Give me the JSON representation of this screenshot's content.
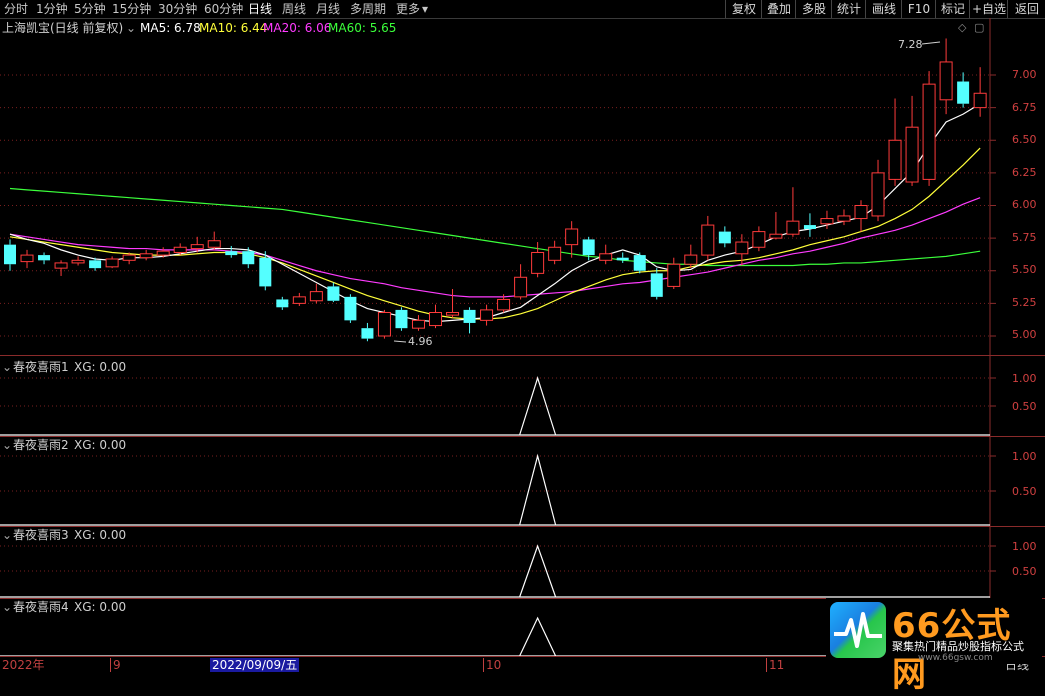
{
  "toolbar": {
    "periods": [
      "分时",
      "1分钟",
      "5分钟",
      "15分钟",
      "30分钟",
      "60分钟",
      "日线",
      "周线",
      "月线",
      "多周期",
      "更多"
    ],
    "active_period": "日线",
    "right_buttons": [
      "复权",
      "叠加",
      "多股",
      "统计",
      "画线",
      "F10",
      "标记",
      "+自选",
      "返回"
    ]
  },
  "main": {
    "title": "上海凯宝(日线 前复权)",
    "ma5": "MA5: 6.78",
    "ma10": "MA10: 6.44",
    "ma20": "MA20: 6.06",
    "ma60": "MA60: 5.65",
    "high_label": "7.28",
    "low_label": "4.96",
    "y_ticks": [
      "7.00",
      "6.75",
      "6.50",
      "6.25",
      "6.00",
      "5.75",
      "5.50",
      "5.25",
      "5.00"
    ]
  },
  "indicators": [
    {
      "title": "春夜喜雨1",
      "value": "XG: 0.00",
      "ticks": [
        "1.00",
        "0.50"
      ]
    },
    {
      "title": "春夜喜雨2",
      "value": "XG: 0.00",
      "ticks": [
        "1.00",
        "0.50"
      ]
    },
    {
      "title": "春夜喜雨3",
      "value": "XG: 0.00",
      "ticks": [
        "1.00",
        "0.50"
      ]
    },
    {
      "title": "春夜喜雨4",
      "value": "XG: 0.00",
      "ticks": []
    }
  ],
  "date_axis": {
    "labels": [
      "2022年",
      "9",
      "2022/09/09/五",
      "10",
      "11"
    ],
    "period": "日线"
  },
  "watermark": {
    "brand": "66公式网",
    "tagline": "聚集热门精品炒股指标公式",
    "url": "www.66gsw.com"
  },
  "colors": {
    "up": "#ff3b3b",
    "down": "#54ffff",
    "ma5": "#ffffff",
    "ma10": "#ffff3a",
    "ma20": "#ff3bff",
    "ma60": "#3bff3b",
    "grid": "#7a1f1f"
  },
  "chart_data": {
    "type": "candlestick",
    "y_range": [
      4.9,
      7.3
    ],
    "candles": [
      [
        5.7,
        5.55,
        5.74,
        5.5
      ],
      [
        5.57,
        5.62,
        5.66,
        5.52
      ],
      [
        5.62,
        5.58,
        5.64,
        5.55
      ],
      [
        5.52,
        5.56,
        5.58,
        5.46
      ],
      [
        5.56,
        5.58,
        5.61,
        5.54
      ],
      [
        5.58,
        5.52,
        5.6,
        5.5
      ],
      [
        5.53,
        5.59,
        5.61,
        5.52
      ],
      [
        5.58,
        5.62,
        5.64,
        5.55
      ],
      [
        5.6,
        5.63,
        5.66,
        5.58
      ],
      [
        5.62,
        5.65,
        5.68,
        5.6
      ],
      [
        5.64,
        5.68,
        5.71,
        5.62
      ],
      [
        5.67,
        5.7,
        5.76,
        5.64
      ],
      [
        5.68,
        5.73,
        5.8,
        5.66
      ],
      [
        5.65,
        5.62,
        5.69,
        5.6
      ],
      [
        5.65,
        5.55,
        5.68,
        5.52
      ],
      [
        5.6,
        5.38,
        5.65,
        5.35
      ],
      [
        5.28,
        5.22,
        5.3,
        5.2
      ],
      [
        5.25,
        5.3,
        5.33,
        5.23
      ],
      [
        5.27,
        5.34,
        5.4,
        5.25
      ],
      [
        5.38,
        5.27,
        5.41,
        5.26
      ],
      [
        5.3,
        5.12,
        5.32,
        5.1
      ],
      [
        5.06,
        4.98,
        5.1,
        4.96
      ],
      [
        5.0,
        5.18,
        5.2,
        4.98
      ],
      [
        5.2,
        5.06,
        5.22,
        5.04
      ],
      [
        5.06,
        5.12,
        5.16,
        5.04
      ],
      [
        5.08,
        5.18,
        5.24,
        5.06
      ],
      [
        5.16,
        5.18,
        5.36,
        5.14
      ],
      [
        5.2,
        5.1,
        5.22,
        5.02
      ],
      [
        5.12,
        5.2,
        5.24,
        5.08
      ],
      [
        5.2,
        5.28,
        5.32,
        5.18
      ],
      [
        5.3,
        5.45,
        5.55,
        5.28
      ],
      [
        5.48,
        5.64,
        5.72,
        5.45
      ],
      [
        5.58,
        5.68,
        5.73,
        5.55
      ],
      [
        5.7,
        5.82,
        5.88,
        5.6
      ],
      [
        5.74,
        5.62,
        5.76,
        5.58
      ],
      [
        5.58,
        5.63,
        5.7,
        5.55
      ],
      [
        5.6,
        5.58,
        5.64,
        5.56
      ],
      [
        5.62,
        5.5,
        5.64,
        5.48
      ],
      [
        5.48,
        5.3,
        5.52,
        5.28
      ],
      [
        5.38,
        5.55,
        5.6,
        5.36
      ],
      [
        5.55,
        5.62,
        5.7,
        5.52
      ],
      [
        5.62,
        5.85,
        5.92,
        5.58
      ],
      [
        5.8,
        5.71,
        5.84,
        5.68
      ],
      [
        5.63,
        5.72,
        5.78,
        5.54
      ],
      [
        5.68,
        5.8,
        5.84,
        5.65
      ],
      [
        5.75,
        5.78,
        5.95,
        5.74
      ],
      [
        5.78,
        5.88,
        6.14,
        5.76
      ],
      [
        5.85,
        5.82,
        5.94,
        5.76
      ],
      [
        5.86,
        5.9,
        5.96,
        5.82
      ],
      [
        5.88,
        5.92,
        5.97,
        5.85
      ],
      [
        5.9,
        6.0,
        6.04,
        5.8
      ],
      [
        5.92,
        6.25,
        6.35,
        5.88
      ],
      [
        6.2,
        6.5,
        6.82,
        6.15
      ],
      [
        6.18,
        6.6,
        6.84,
        6.15
      ],
      [
        6.2,
        6.93,
        7.03,
        6.15
      ],
      [
        6.81,
        7.1,
        7.28,
        6.7
      ],
      [
        6.95,
        6.78,
        7.02,
        6.75
      ],
      [
        6.75,
        6.86,
        7.06,
        6.68
      ]
    ],
    "ma5": [
      5.78,
      5.74,
      5.71,
      5.66,
      5.62,
      5.59,
      5.58,
      5.6,
      5.6,
      5.61,
      5.63,
      5.65,
      5.67,
      5.67,
      5.66,
      5.62,
      5.55,
      5.48,
      5.41,
      5.34,
      5.27,
      5.21,
      5.18,
      5.15,
      5.12,
      5.11,
      5.12,
      5.13,
      5.14,
      5.18,
      5.22,
      5.31,
      5.4,
      5.5,
      5.57,
      5.62,
      5.66,
      5.62,
      5.53,
      5.5,
      5.51,
      5.58,
      5.62,
      5.65,
      5.7,
      5.76,
      5.8,
      5.82,
      5.85,
      5.88,
      5.91,
      6.0,
      6.13,
      6.26,
      6.46,
      6.64,
      6.7,
      6.78
    ],
    "ma10": [
      5.76,
      5.74,
      5.72,
      5.7,
      5.68,
      5.66,
      5.64,
      5.63,
      5.62,
      5.62,
      5.62,
      5.63,
      5.64,
      5.64,
      5.63,
      5.6,
      5.56,
      5.51,
      5.46,
      5.41,
      5.36,
      5.31,
      5.27,
      5.23,
      5.19,
      5.16,
      5.14,
      5.13,
      5.13,
      5.14,
      5.17,
      5.21,
      5.27,
      5.33,
      5.38,
      5.43,
      5.47,
      5.49,
      5.5,
      5.5,
      5.53,
      5.55,
      5.57,
      5.58,
      5.6,
      5.63,
      5.66,
      5.7,
      5.73,
      5.76,
      5.8,
      5.84,
      5.9,
      5.97,
      6.07,
      6.19,
      6.31,
      6.44
    ],
    "ma20": [
      5.78,
      5.76,
      5.74,
      5.72,
      5.7,
      5.69,
      5.68,
      5.67,
      5.67,
      5.66,
      5.66,
      5.66,
      5.66,
      5.65,
      5.64,
      5.62,
      5.58,
      5.54,
      5.5,
      5.47,
      5.44,
      5.42,
      5.4,
      5.37,
      5.35,
      5.33,
      5.31,
      5.3,
      5.3,
      5.3,
      5.31,
      5.32,
      5.33,
      5.34,
      5.36,
      5.38,
      5.4,
      5.41,
      5.43,
      5.45,
      5.47,
      5.49,
      5.52,
      5.55,
      5.58,
      5.6,
      5.63,
      5.65,
      5.68,
      5.71,
      5.75,
      5.78,
      5.81,
      5.85,
      5.9,
      5.95,
      6.01,
      6.06
    ],
    "ma60": [
      6.13,
      6.12,
      6.11,
      6.1,
      6.09,
      6.08,
      6.07,
      6.06,
      6.05,
      6.04,
      6.03,
      6.02,
      6.01,
      6.0,
      5.99,
      5.98,
      5.97,
      5.95,
      5.93,
      5.91,
      5.89,
      5.87,
      5.85,
      5.83,
      5.81,
      5.79,
      5.77,
      5.75,
      5.73,
      5.71,
      5.69,
      5.67,
      5.65,
      5.63,
      5.61,
      5.6,
      5.58,
      5.57,
      5.56,
      5.55,
      5.55,
      5.54,
      5.54,
      5.54,
      5.54,
      5.54,
      5.54,
      5.55,
      5.55,
      5.56,
      5.56,
      5.57,
      5.58,
      5.59,
      5.6,
      5.61,
      5.63,
      5.65
    ],
    "signal_index": 31
  }
}
